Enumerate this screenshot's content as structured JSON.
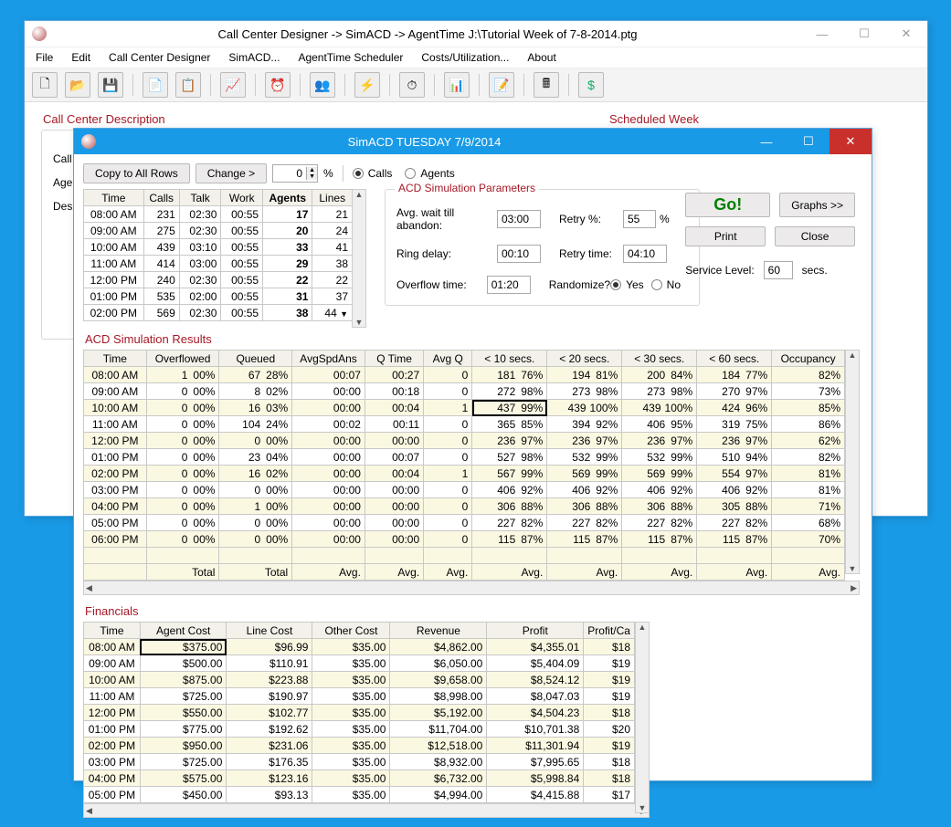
{
  "mainWindow": {
    "title": "Call Center Designer ->  SimACD ->  AgentTime      J:\\Tutorial Week of  7-8-2014.ptg",
    "menus": [
      "File",
      "Edit",
      "Call Center Designer",
      "SimACD...",
      "AgentTime Scheduler",
      "Costs/Utilization...",
      "About"
    ],
    "labels": {
      "ccd": "Call Center Description",
      "sw": "Scheduled Week",
      "call": "Call",
      "age": "Age",
      "des": "Des"
    }
  },
  "simWindow": {
    "title": "SimACD   TUESDAY   7/9/2014",
    "controls": {
      "copy": "Copy to All Rows",
      "change": "Change >",
      "spinVal": "0",
      "pct": "%",
      "radioCalls": "Calls",
      "radioAgents": "Agents"
    },
    "paramsTitle": "ACD Simulation Parameters",
    "params": {
      "avgWaitLbl": "Avg. wait till abandon:",
      "avgWaitVal": "03:00",
      "retryPctLbl": "Retry %:",
      "retryPctVal": "55",
      "retryPctUnit": "%",
      "ringLbl": "Ring delay:",
      "ringVal": "00:10",
      "retryTimeLbl": "Retry time:",
      "retryTimeVal": "04:10",
      "overflowLbl": "Overflow time:",
      "overflowVal": "01:20",
      "randLbl": "Randomize?",
      "yes": "Yes",
      "no": "No",
      "svcLvlLbl": "Service Level:",
      "svcLvlVal": "60",
      "svcLvlUnit": "secs."
    },
    "buttons": {
      "go": "Go!",
      "graphs": "Graphs >>",
      "print": "Print",
      "close": "Close"
    },
    "inputHdr": [
      "Time",
      "Calls",
      "Talk",
      "Work",
      "Agents",
      "Lines"
    ],
    "inputRows": [
      [
        "08:00 AM",
        "231",
        "02:30",
        "00:55",
        "17",
        "21"
      ],
      [
        "09:00 AM",
        "275",
        "02:30",
        "00:55",
        "20",
        "24"
      ],
      [
        "10:00 AM",
        "439",
        "03:10",
        "00:55",
        "33",
        "41"
      ],
      [
        "11:00 AM",
        "414",
        "03:00",
        "00:55",
        "29",
        "38"
      ],
      [
        "12:00 PM",
        "240",
        "02:30",
        "00:55",
        "22",
        "22"
      ],
      [
        "01:00 PM",
        "535",
        "02:00",
        "00:55",
        "31",
        "37"
      ],
      [
        "02:00 PM",
        "569",
        "02:30",
        "00:55",
        "38",
        "44"
      ]
    ],
    "resultsTitle": "ACD Simulation Results",
    "resHdr": [
      "Time",
      "Overflowed",
      "Queued",
      "AvgSpdAns",
      "Q Time",
      "Avg Q",
      "< 10 secs.",
      "< 20 secs.",
      "< 30 secs.",
      "< 60 secs.",
      "Occupancy"
    ],
    "resRows": [
      {
        "t": "08:00 AM",
        "ovf": "1",
        "ovfp": "00%",
        "q": "67",
        "qp": "28%",
        "asa": "00:07",
        "qt": "00:27",
        "aq": "0",
        "s10": "181",
        "p10": "76%",
        "s20": "194",
        "p20": "81%",
        "s30": "200",
        "p30": "84%",
        "s60": "184",
        "p60": "77%",
        "occ": "82%"
      },
      {
        "t": "09:00 AM",
        "ovf": "0",
        "ovfp": "00%",
        "q": "8",
        "qp": "02%",
        "asa": "00:00",
        "qt": "00:18",
        "aq": "0",
        "s10": "272",
        "p10": "98%",
        "s20": "273",
        "p20": "98%",
        "s30": "273",
        "p30": "98%",
        "s60": "270",
        "p60": "97%",
        "occ": "73%"
      },
      {
        "t": "10:00 AM",
        "ovf": "0",
        "ovfp": "00%",
        "q": "16",
        "qp": "03%",
        "asa": "00:00",
        "qt": "00:04",
        "aq": "1",
        "s10": "437",
        "p10": "99%",
        "s20": "439",
        "p20": "100%",
        "s30": "439",
        "p30": "100%",
        "s60": "424",
        "p60": "96%",
        "occ": "85%",
        "hi": true
      },
      {
        "t": "11:00 AM",
        "ovf": "0",
        "ovfp": "00%",
        "q": "104",
        "qp": "24%",
        "asa": "00:02",
        "qt": "00:11",
        "aq": "0",
        "s10": "365",
        "p10": "85%",
        "s20": "394",
        "p20": "92%",
        "s30": "406",
        "p30": "95%",
        "s60": "319",
        "p60": "75%",
        "occ": "86%"
      },
      {
        "t": "12:00 PM",
        "ovf": "0",
        "ovfp": "00%",
        "q": "0",
        "qp": "00%",
        "asa": "00:00",
        "qt": "00:00",
        "aq": "0",
        "s10": "236",
        "p10": "97%",
        "s20": "236",
        "p20": "97%",
        "s30": "236",
        "p30": "97%",
        "s60": "236",
        "p60": "97%",
        "occ": "62%"
      },
      {
        "t": "01:00 PM",
        "ovf": "0",
        "ovfp": "00%",
        "q": "23",
        "qp": "04%",
        "asa": "00:00",
        "qt": "00:07",
        "aq": "0",
        "s10": "527",
        "p10": "98%",
        "s20": "532",
        "p20": "99%",
        "s30": "532",
        "p30": "99%",
        "s60": "510",
        "p60": "94%",
        "occ": "82%"
      },
      {
        "t": "02:00 PM",
        "ovf": "0",
        "ovfp": "00%",
        "q": "16",
        "qp": "02%",
        "asa": "00:00",
        "qt": "00:04",
        "aq": "1",
        "s10": "567",
        "p10": "99%",
        "s20": "569",
        "p20": "99%",
        "s30": "569",
        "p30": "99%",
        "s60": "554",
        "p60": "97%",
        "occ": "81%"
      },
      {
        "t": "03:00 PM",
        "ovf": "0",
        "ovfp": "00%",
        "q": "0",
        "qp": "00%",
        "asa": "00:00",
        "qt": "00:00",
        "aq": "0",
        "s10": "406",
        "p10": "92%",
        "s20": "406",
        "p20": "92%",
        "s30": "406",
        "p30": "92%",
        "s60": "406",
        "p60": "92%",
        "occ": "81%"
      },
      {
        "t": "04:00 PM",
        "ovf": "0",
        "ovfp": "00%",
        "q": "1",
        "qp": "00%",
        "asa": "00:00",
        "qt": "00:00",
        "aq": "0",
        "s10": "306",
        "p10": "88%",
        "s20": "306",
        "p20": "88%",
        "s30": "306",
        "p30": "88%",
        "s60": "305",
        "p60": "88%",
        "occ": "71%"
      },
      {
        "t": "05:00 PM",
        "ovf": "0",
        "ovfp": "00%",
        "q": "0",
        "qp": "00%",
        "asa": "00:00",
        "qt": "00:00",
        "aq": "0",
        "s10": "227",
        "p10": "82%",
        "s20": "227",
        "p20": "82%",
        "s30": "227",
        "p30": "82%",
        "s60": "227",
        "p60": "82%",
        "occ": "68%"
      },
      {
        "t": "06:00 PM",
        "ovf": "0",
        "ovfp": "00%",
        "q": "0",
        "qp": "00%",
        "asa": "00:00",
        "qt": "00:00",
        "aq": "0",
        "s10": "115",
        "p10": "87%",
        "s20": "115",
        "p20": "87%",
        "s30": "115",
        "p30": "87%",
        "s60": "115",
        "p60": "87%",
        "occ": "70%"
      }
    ],
    "resFooter": [
      "",
      "Total",
      "Total",
      "Avg.",
      "Avg.",
      "Avg.",
      "Avg.",
      "Avg.",
      "Avg.",
      "Avg.",
      "Avg."
    ],
    "finTitle": "Financials",
    "finHdr": [
      "Time",
      "Agent Cost",
      "Line Cost",
      "Other Cost",
      "Revenue",
      "Profit",
      "Profit/Ca"
    ],
    "finRows": [
      [
        "08:00 AM",
        "$375.00",
        "$96.99",
        "$35.00",
        "$4,862.00",
        "$4,355.01",
        "$18"
      ],
      [
        "09:00 AM",
        "$500.00",
        "$110.91",
        "$35.00",
        "$6,050.00",
        "$5,404.09",
        "$19"
      ],
      [
        "10:00 AM",
        "$875.00",
        "$223.88",
        "$35.00",
        "$9,658.00",
        "$8,524.12",
        "$19"
      ],
      [
        "11:00 AM",
        "$725.00",
        "$190.97",
        "$35.00",
        "$8,998.00",
        "$8,047.03",
        "$19"
      ],
      [
        "12:00 PM",
        "$550.00",
        "$102.77",
        "$35.00",
        "$5,192.00",
        "$4,504.23",
        "$18"
      ],
      [
        "01:00 PM",
        "$775.00",
        "$192.62",
        "$35.00",
        "$11,704.00",
        "$10,701.38",
        "$20"
      ],
      [
        "02:00 PM",
        "$950.00",
        "$231.06",
        "$35.00",
        "$12,518.00",
        "$11,301.94",
        "$19"
      ],
      [
        "03:00 PM",
        "$725.00",
        "$176.35",
        "$35.00",
        "$8,932.00",
        "$7,995.65",
        "$18"
      ],
      [
        "04:00 PM",
        "$575.00",
        "$123.16",
        "$35.00",
        "$6,732.00",
        "$5,998.84",
        "$18"
      ],
      [
        "05:00 PM",
        "$450.00",
        "$93.13",
        "$35.00",
        "$4,994.00",
        "$4,415.88",
        "$17"
      ]
    ]
  },
  "chart_data": [
    {
      "type": "table",
      "title": "Input Grid",
      "columns": [
        "Time",
        "Calls",
        "Talk",
        "Work",
        "Agents",
        "Lines"
      ],
      "rows": [
        [
          "08:00 AM",
          231,
          "02:30",
          "00:55",
          17,
          21
        ],
        [
          "09:00 AM",
          275,
          "02:30",
          "00:55",
          20,
          24
        ],
        [
          "10:00 AM",
          439,
          "03:10",
          "00:55",
          33,
          41
        ],
        [
          "11:00 AM",
          414,
          "03:00",
          "00:55",
          29,
          38
        ],
        [
          "12:00 PM",
          240,
          "02:30",
          "00:55",
          22,
          22
        ],
        [
          "01:00 PM",
          535,
          "02:00",
          "00:55",
          31,
          37
        ],
        [
          "02:00 PM",
          569,
          "02:30",
          "00:55",
          38,
          44
        ]
      ]
    },
    {
      "type": "table",
      "title": "ACD Simulation Results",
      "columns": [
        "Time",
        "Overflowed",
        "Overflowed%",
        "Queued",
        "Queued%",
        "AvgSpdAns",
        "QTime",
        "AvgQ",
        "<10 n",
        "<10 %",
        "<20 n",
        "<20 %",
        "<30 n",
        "<30 %",
        "<60 n",
        "<60 %",
        "Occupancy%"
      ],
      "rows": [
        [
          "08:00 AM",
          1,
          0,
          67,
          28,
          "00:07",
          "00:27",
          0,
          181,
          76,
          194,
          81,
          200,
          84,
          184,
          77,
          82
        ],
        [
          "09:00 AM",
          0,
          0,
          8,
          2,
          "00:00",
          "00:18",
          0,
          272,
          98,
          273,
          98,
          273,
          98,
          270,
          97,
          73
        ],
        [
          "10:00 AM",
          0,
          0,
          16,
          3,
          "00:00",
          "00:04",
          1,
          437,
          99,
          439,
          100,
          439,
          100,
          424,
          96,
          85
        ],
        [
          "11:00 AM",
          0,
          0,
          104,
          24,
          "00:02",
          "00:11",
          0,
          365,
          85,
          394,
          92,
          406,
          95,
          319,
          75,
          86
        ],
        [
          "12:00 PM",
          0,
          0,
          0,
          0,
          "00:00",
          "00:00",
          0,
          236,
          97,
          236,
          97,
          236,
          97,
          236,
          97,
          62
        ],
        [
          "01:00 PM",
          0,
          0,
          23,
          4,
          "00:00",
          "00:07",
          0,
          527,
          98,
          532,
          99,
          532,
          99,
          510,
          94,
          82
        ],
        [
          "02:00 PM",
          0,
          0,
          16,
          2,
          "00:00",
          "00:04",
          1,
          567,
          99,
          569,
          99,
          569,
          99,
          554,
          97,
          81
        ],
        [
          "03:00 PM",
          0,
          0,
          0,
          0,
          "00:00",
          "00:00",
          0,
          406,
          92,
          406,
          92,
          406,
          92,
          406,
          92,
          81
        ],
        [
          "04:00 PM",
          0,
          0,
          1,
          0,
          "00:00",
          "00:00",
          0,
          306,
          88,
          306,
          88,
          306,
          88,
          305,
          88,
          71
        ],
        [
          "05:00 PM",
          0,
          0,
          0,
          0,
          "00:00",
          "00:00",
          0,
          227,
          82,
          227,
          82,
          227,
          82,
          227,
          82,
          68
        ],
        [
          "06:00 PM",
          0,
          0,
          0,
          0,
          "00:00",
          "00:00",
          0,
          115,
          87,
          115,
          87,
          115,
          87,
          115,
          87,
          70
        ]
      ]
    },
    {
      "type": "table",
      "title": "Financials",
      "columns": [
        "Time",
        "Agent Cost",
        "Line Cost",
        "Other Cost",
        "Revenue",
        "Profit",
        "Profit/Call"
      ],
      "rows": [
        [
          "08:00 AM",
          375.0,
          96.99,
          35.0,
          4862.0,
          4355.01,
          18
        ],
        [
          "09:00 AM",
          500.0,
          110.91,
          35.0,
          6050.0,
          5404.09,
          19
        ],
        [
          "10:00 AM",
          875.0,
          223.88,
          35.0,
          9658.0,
          8524.12,
          19
        ],
        [
          "11:00 AM",
          725.0,
          190.97,
          35.0,
          8998.0,
          8047.03,
          19
        ],
        [
          "12:00 PM",
          550.0,
          102.77,
          35.0,
          5192.0,
          4504.23,
          18
        ],
        [
          "01:00 PM",
          775.0,
          192.62,
          35.0,
          11704.0,
          10701.38,
          20
        ],
        [
          "02:00 PM",
          950.0,
          231.06,
          35.0,
          12518.0,
          11301.94,
          19
        ],
        [
          "03:00 PM",
          725.0,
          176.35,
          35.0,
          8932.0,
          7995.65,
          18
        ],
        [
          "04:00 PM",
          575.0,
          123.16,
          35.0,
          6732.0,
          5998.84,
          18
        ],
        [
          "05:00 PM",
          450.0,
          93.13,
          35.0,
          4994.0,
          4415.88,
          17
        ]
      ]
    }
  ]
}
